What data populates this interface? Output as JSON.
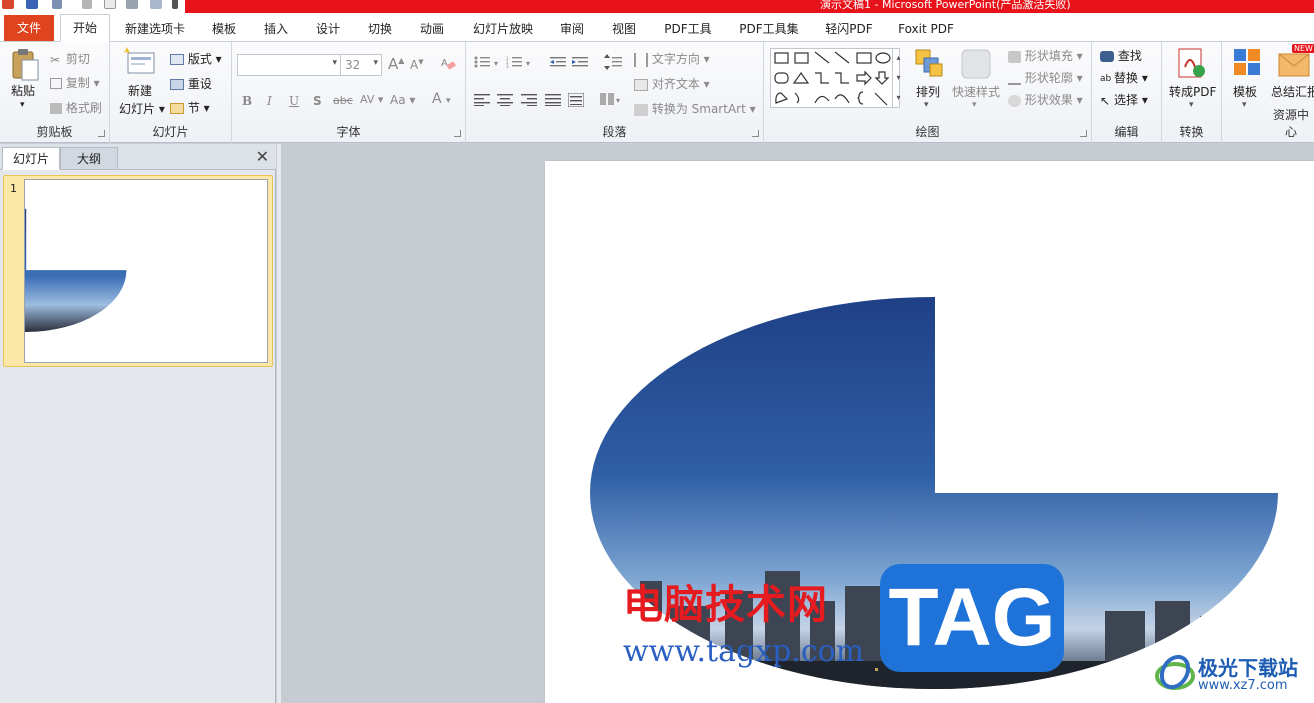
{
  "window": {
    "title": "演示文稿1 - Microsoft PowerPoint(产品激活失败)"
  },
  "tabs": [
    {
      "label": "文件"
    },
    {
      "label": "开始"
    },
    {
      "label": "新建选项卡"
    },
    {
      "label": "模板"
    },
    {
      "label": "插入"
    },
    {
      "label": "设计"
    },
    {
      "label": "切换"
    },
    {
      "label": "动画"
    },
    {
      "label": "幻灯片放映"
    },
    {
      "label": "审阅"
    },
    {
      "label": "视图"
    },
    {
      "label": "PDF工具"
    },
    {
      "label": "PDF工具集"
    },
    {
      "label": "轻闪PDF"
    },
    {
      "label": "Foxit PDF"
    }
  ],
  "ribbon": {
    "clipboard": {
      "label": "剪贴板",
      "paste": "粘贴",
      "cut": "剪切",
      "copy": "复制",
      "format_painter": "格式刷"
    },
    "slides": {
      "label": "幻灯片",
      "new_slide_1": "新建",
      "new_slide_2": "幻灯片",
      "layout": "版式",
      "reset": "重设",
      "section": "节"
    },
    "font": {
      "label": "字体",
      "font_name": "",
      "font_size": "32",
      "bold": "B",
      "italic": "I",
      "underline": "U",
      "shadow": "S",
      "strike": "abc",
      "spacing": "AV",
      "case": "Aa",
      "color": "A",
      "grow": "A",
      "shrink": "A"
    },
    "paragraph": {
      "label": "段落",
      "text_direction": "文字方向",
      "align_text": "对齐文本",
      "smartart": "转换为 SmartArt"
    },
    "drawing": {
      "label": "绘图",
      "arrange": "排列",
      "quick_styles": "快速样式",
      "shape_fill": "形状填充",
      "shape_outline": "形状轮廓",
      "shape_effects": "形状效果"
    },
    "editing": {
      "label": "编辑",
      "find": "查找",
      "replace": "替换",
      "select": "选择"
    },
    "convert": {
      "label": "转换",
      "to_pdf": "转成PDF"
    },
    "resources": {
      "label": "资源中心",
      "templates": "模板",
      "summary": "总结汇报",
      "new_badge": "NEW"
    }
  },
  "left_pane": {
    "tab_slides": "幻灯片",
    "tab_outline": "大纲",
    "close": "✕",
    "slide_number": "1"
  },
  "watermark": {
    "cn_text": "电脑技术网",
    "url": "www.tagxp.com",
    "tag": "TAG",
    "site_name": "极光下载站",
    "site_url": "www.xz7.com"
  },
  "colors": {
    "title_red": "#e8121a",
    "file_tab": "#e0441f",
    "thumb_highlight": "#fbe7a7",
    "sky_top": "#1e3f85",
    "sky_bottom": "#7ea6d2",
    "tag_blue": "#1f73d8"
  }
}
